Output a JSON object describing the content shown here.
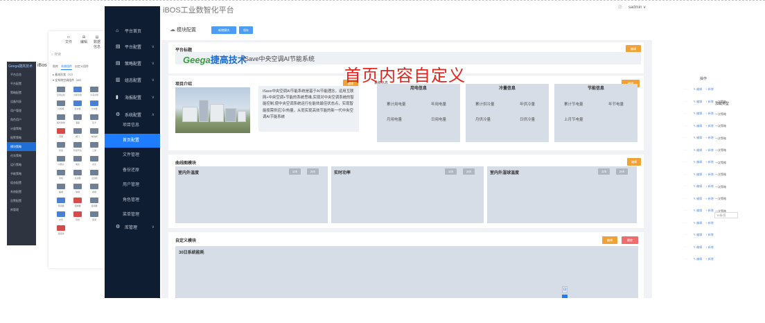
{
  "background_sidebar": {
    "logo": "Geega捷高技术",
    "items": [
      {
        "label": "平台总览",
        "active": false
      },
      {
        "label": "平台配置",
        "active": false
      },
      {
        "label": "策略配置",
        "active": false
      },
      {
        "label": "设备列表",
        "active": false
      },
      {
        "label": "用户管理",
        "active": false
      },
      {
        "label": "角色用户",
        "active": false
      },
      {
        "label": "计量策略",
        "active": false
      },
      {
        "label": "报警策略",
        "active": false
      },
      {
        "label": "模块策略",
        "active": true
      },
      {
        "label": "任务策略",
        "active": false
      },
      {
        "label": "运行策略",
        "active": false
      },
      {
        "label": "节能策略",
        "active": false
      },
      {
        "label": "组态配置",
        "active": false
      },
      {
        "label": "系统配置",
        "active": false
      },
      {
        "label": "告警配置",
        "active": false
      },
      {
        "label": "库管理",
        "active": false
      }
    ]
  },
  "background_palette": {
    "title": "iBos",
    "tools": [
      {
        "label": "文件"
      },
      {
        "label": "编辑"
      },
      {
        "label": "数据信息"
      }
    ],
    "search_placeholder": "搜索",
    "tabs": [
      {
        "label": "图库",
        "active": false
      },
      {
        "label": "系统组件",
        "active": true
      },
      {
        "label": "自定义组件",
        "active": false
      }
    ],
    "tree": [
      {
        "label": "基本形状（72）"
      },
      {
        "label": "全系统空调组件（45）"
      }
    ],
    "components": [
      {
        "label": "空调主机",
        "tone": "g"
      },
      {
        "label": "冷却水泵",
        "tone": "b"
      },
      {
        "label": "冷冻水泵",
        "tone": "g"
      },
      {
        "label": "冷却塔",
        "tone": "g"
      },
      {
        "label": "集水器",
        "tone": "b"
      },
      {
        "label": "分水器",
        "tone": "b"
      },
      {
        "label": "板式换热",
        "tone": "g"
      },
      {
        "label": "温度",
        "tone": "g"
      },
      {
        "label": "压力",
        "tone": "g"
      },
      {
        "label": "流量",
        "tone": "r"
      },
      {
        "label": "阀门",
        "tone": "g"
      },
      {
        "label": "电动阀",
        "tone": "g"
      },
      {
        "label": "管道",
        "tone": "g"
      },
      {
        "label": "管道弯头",
        "tone": "g"
      },
      {
        "label": "三通",
        "tone": "g"
      },
      {
        "label": "冷量表",
        "tone": "g"
      },
      {
        "label": "电表",
        "tone": "g"
      },
      {
        "label": "水表",
        "tone": "g"
      },
      {
        "label": "风机",
        "tone": "g"
      },
      {
        "label": "过滤器",
        "tone": "g"
      },
      {
        "label": "止回阀",
        "tone": "g"
      },
      {
        "label": "蝶阀",
        "tone": "g"
      },
      {
        "label": "球阀",
        "tone": "g"
      },
      {
        "label": "闸阀",
        "tone": "g"
      },
      {
        "label": "传感器",
        "tone": "b"
      },
      {
        "label": "控制器",
        "tone": "r"
      },
      {
        "label": "变频器",
        "tone": "g"
      },
      {
        "label": "水管",
        "tone": "b"
      },
      {
        "label": "风管",
        "tone": "r"
      },
      {
        "label": "旁通",
        "tone": "g"
      },
      {
        "label": "连接线",
        "tone": "r"
      }
    ]
  },
  "background_table": {
    "ops_header": "操作",
    "type_header": "加载类型",
    "rows": [
      {
        "edit": "编辑",
        "add": "新增",
        "type": ""
      },
      {
        "edit": "编辑",
        "add": "新增",
        "type": "一次策略"
      },
      {
        "edit": "编辑",
        "add": "新增",
        "type": "一次策略"
      },
      {
        "edit": "编辑",
        "add": "新增",
        "type": "一次策略"
      },
      {
        "edit": "编辑",
        "add": "新增",
        "type": "一次策略"
      },
      {
        "edit": "编辑",
        "add": "新增",
        "type": "一次策略"
      },
      {
        "edit": "编辑",
        "add": "新增",
        "type": "一次策略"
      },
      {
        "edit": "编辑",
        "add": "新增",
        "type": "一次策略"
      },
      {
        "edit": "编辑",
        "add": "新增",
        "type": "一次策略"
      },
      {
        "edit": "编辑",
        "add": "新增",
        "type": "一次策略"
      },
      {
        "edit": "编辑",
        "add": "新增",
        "type": "一次策略"
      },
      {
        "edit": "编辑",
        "add": "新增",
        "type": ""
      },
      {
        "edit": "编辑",
        "add": "新增",
        "type": ""
      },
      {
        "edit": "编辑",
        "add": "新增",
        "type": ""
      },
      {
        "edit": "编辑",
        "add": "新增",
        "type": ""
      }
    ],
    "pager": "10条/页"
  },
  "topbar": {
    "title": "iBOS工业数智化平台",
    "user_icon": "user-icon",
    "username": "sadmin ∨"
  },
  "sidebar": {
    "items": [
      {
        "label": "平台首页",
        "icon": "home-icon",
        "glyph": "⌂",
        "arrow": ""
      },
      {
        "label": "平台配置",
        "icon": "grid-icon",
        "glyph": "▤",
        "arrow": "∨"
      },
      {
        "label": "策略配置",
        "icon": "list-icon",
        "glyph": "▤",
        "arrow": "∨"
      },
      {
        "label": "组态配置",
        "icon": "layout-icon",
        "glyph": "▥",
        "arrow": "∨"
      },
      {
        "label": "海报配置",
        "icon": "chart-icon",
        "glyph": "▮",
        "arrow": "∨"
      },
      {
        "label": "系统配置",
        "icon": "gear-icon",
        "glyph": "⚙",
        "arrow": "∧"
      }
    ],
    "subitems": [
      {
        "label": "项目信息",
        "active": false
      },
      {
        "label": "首页配置",
        "active": true
      },
      {
        "label": "文件管理",
        "active": false
      },
      {
        "label": "备份还原",
        "active": false
      },
      {
        "label": "用户管理",
        "active": false
      },
      {
        "label": "角色管理",
        "active": false
      },
      {
        "label": "菜单管理",
        "active": false
      }
    ],
    "last": {
      "label": "库管理",
      "icon": "gear-icon",
      "glyph": "⚙",
      "arrow": "∨"
    }
  },
  "module_bar": {
    "title": "模块配置",
    "icon": "cloud-icon",
    "add_label": "新增模块",
    "save_label": "保存"
  },
  "platform_title": {
    "heading": "平台标题",
    "edit_label": "编辑",
    "logo_text": "Geega",
    "logo_cn": "捷高技术",
    "system_name": "iSave中央空调AI节能系统"
  },
  "overlay_text": "首页内容自定义",
  "project": {
    "heading": "项目介绍",
    "edit_label": "编辑",
    "intro": "iSave中央空调AI节能系统是基于AI节能理念，运用互联网+中央空调+节能的系统思维,实现对中央空调系统的智能控制,使中央空调系统运行在能效最佳状态点，实现智能按需供应冷/热量，从而实现高效节能的新一代中央空调AI节能系统",
    "stats_heading": "系统信息",
    "stats_edit_label": "编辑",
    "columns": [
      {
        "title": "用电信息",
        "items": [
          "累计用电量",
          "年用电量",
          "月用电量",
          "日用电量"
        ]
      },
      {
        "title": "冷量信息",
        "items": [
          "累计供冷量",
          "年供冷量",
          "月供冷量",
          "日供冷量"
        ]
      },
      {
        "title": "节能信息",
        "items": [
          "累计节电量",
          "年节电量",
          "上月节电量"
        ]
      }
    ]
  },
  "curve": {
    "heading": "曲线图模块",
    "edit_label": "编辑",
    "charts": [
      {
        "title": "室内外温度",
        "chips": [
          "12h",
          "24h"
        ]
      },
      {
        "title": "实时功率",
        "chips": [
          "12h",
          "24h"
        ]
      },
      {
        "title": "室内外湿球温度",
        "chips": [
          "12h",
          "24h"
        ]
      }
    ]
  },
  "custom": {
    "heading": "自定义模块",
    "edit_label": "编辑",
    "delete_label": "删除",
    "chart_title": "30日系统能耗"
  }
}
